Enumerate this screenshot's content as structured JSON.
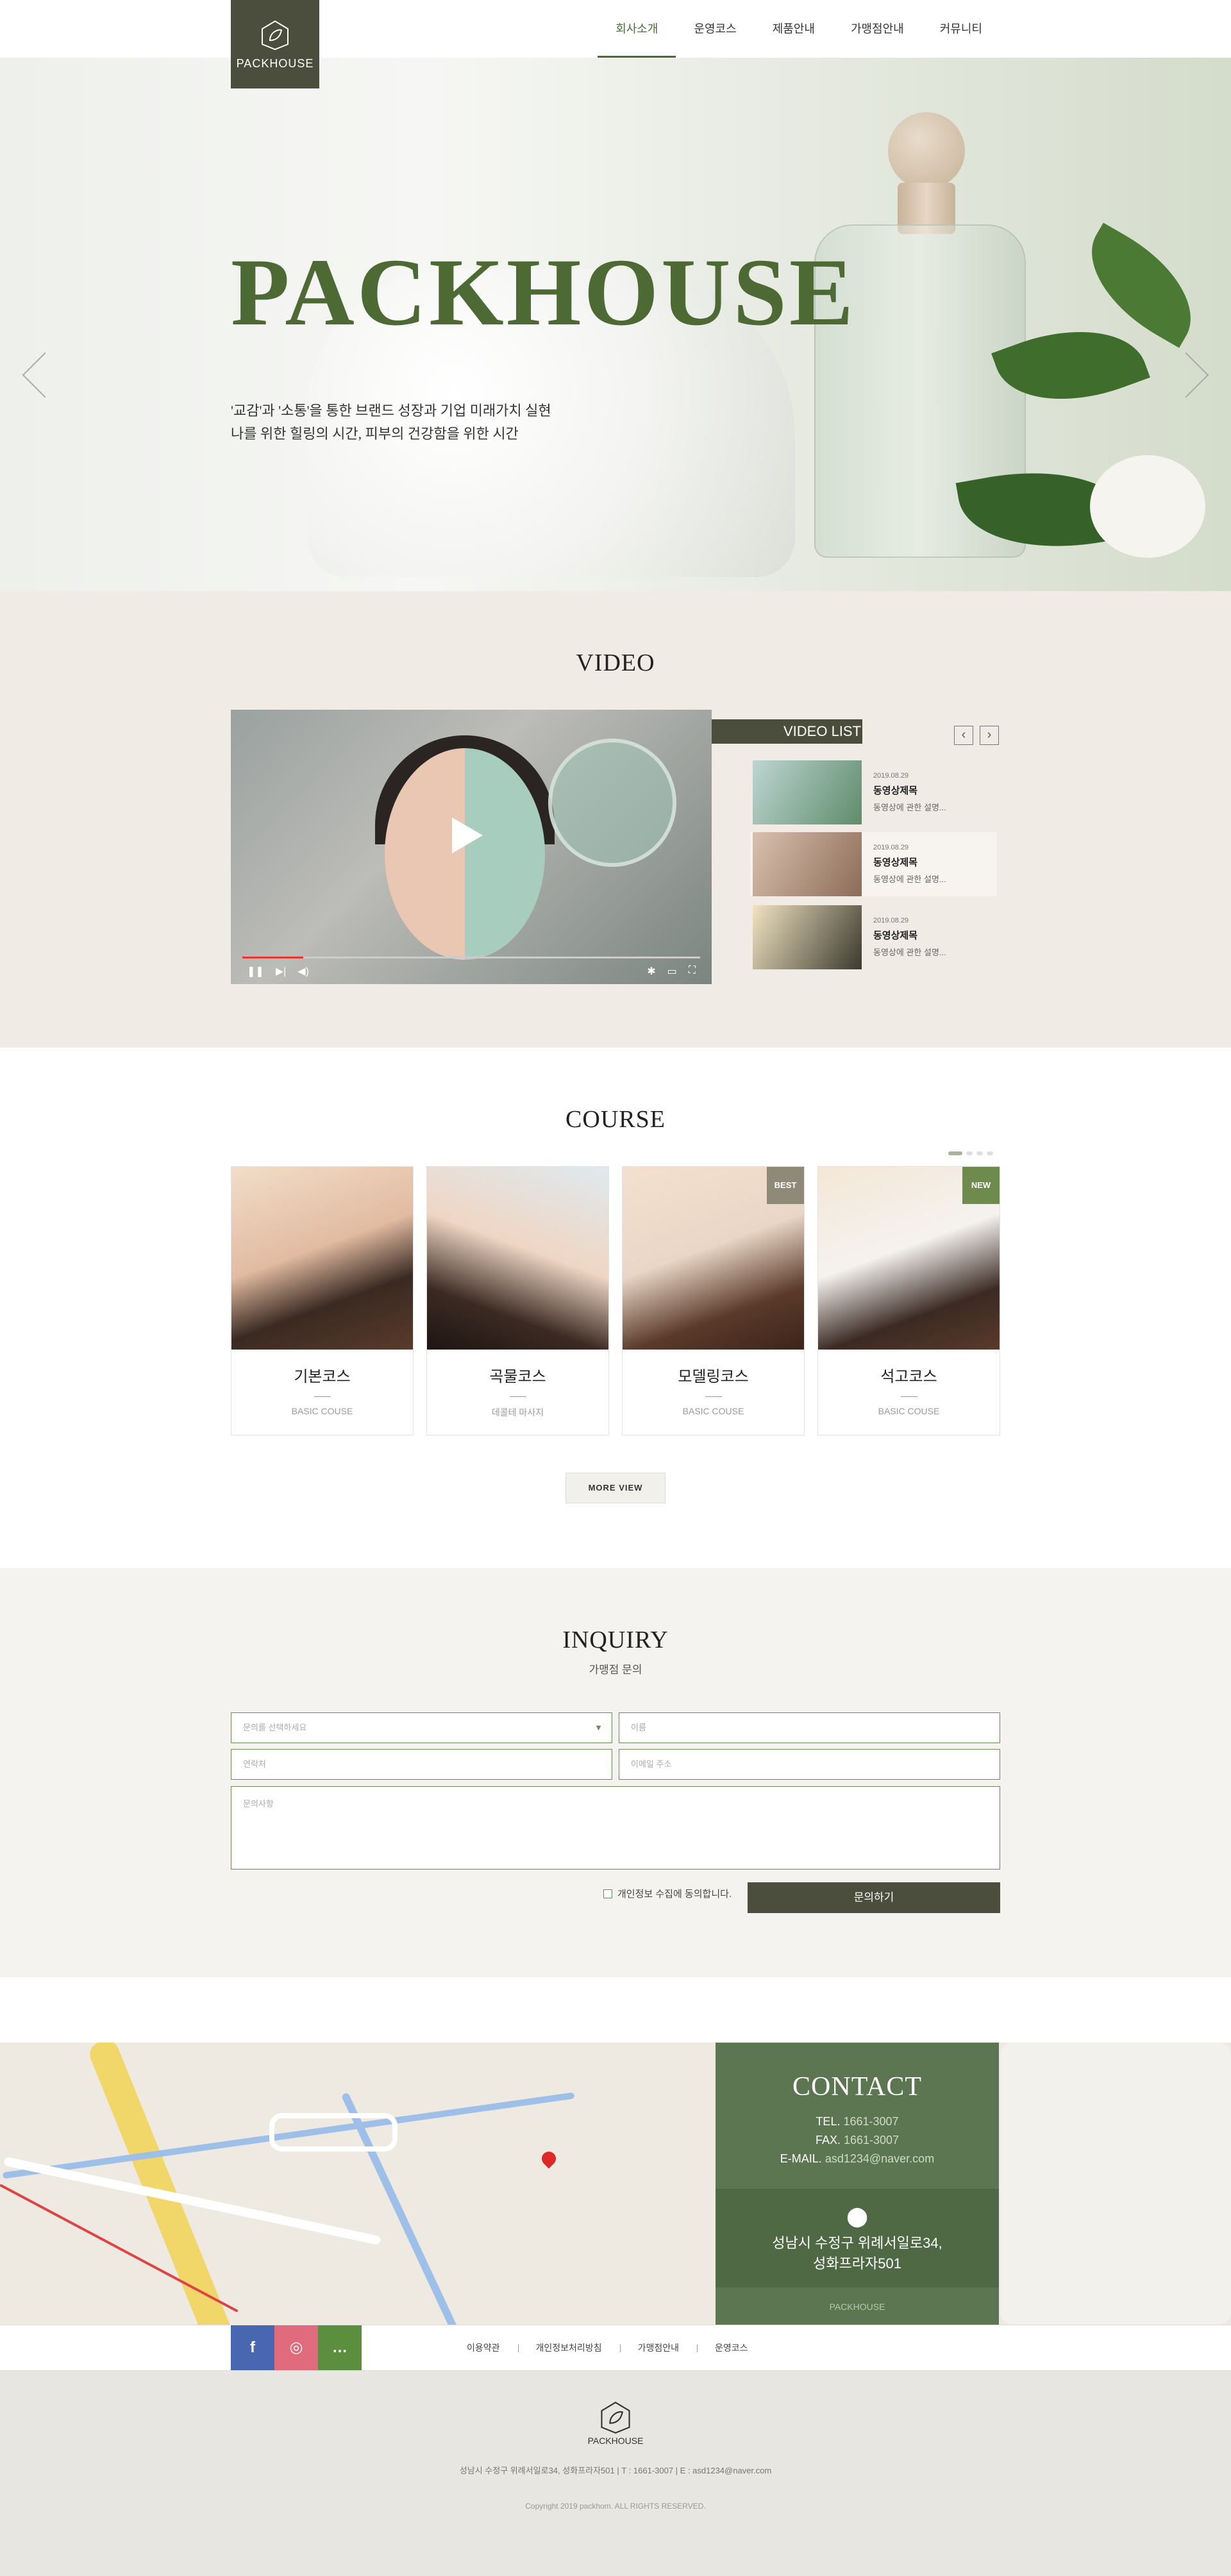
{
  "header": {
    "logo_text": "PACKHOUSE",
    "nav": [
      "회사소개",
      "운영코스",
      "제품안내",
      "가맹점안내",
      "커뮤니티"
    ]
  },
  "hero": {
    "title": "PACKHOUSE",
    "sub_line1": "'교감'과 '소통'을 통한 브랜드 성장과 기업 미래가치 실현",
    "sub_line2": "나를 위한 힐링의 시간, 피부의 건강함을 위한 시간",
    "prev_icon": "chevron-left-icon",
    "next_icon": "chevron-right-icon"
  },
  "video": {
    "title": "VIDEO",
    "list_title": "VIDEO LIST",
    "items": [
      {
        "date": "2019.08.29",
        "title": "동영상제목",
        "desc": "동영상에 관한 설명..."
      },
      {
        "date": "2019.08.29",
        "title": "동영상제목",
        "desc": "동영상에 관한 설명..."
      },
      {
        "date": "2019.08.29",
        "title": "동영상제목",
        "desc": "동영상에 관한 설명..."
      }
    ]
  },
  "course": {
    "title": "COURSE",
    "cards": [
      {
        "name": "기본코스",
        "desc": "BASIC COUSE",
        "badge": ""
      },
      {
        "name": "곡물코스",
        "desc": "데콜테 마사지",
        "badge": ""
      },
      {
        "name": "모델링코스",
        "desc": "BASIC COUSE",
        "badge": "BEST"
      },
      {
        "name": "석고코스",
        "desc": "BASIC COUSE",
        "badge": "NEW"
      }
    ],
    "more_label": "MORE VIEW",
    "colors": {
      "best": "#8f8a77",
      "new": "#6e8a4d"
    }
  },
  "inquiry": {
    "title": "INQUIRY",
    "subtitle": "가맹점 문의",
    "select_placeholder": "문의를 선택하세요",
    "name_placeholder": "이름",
    "phone_placeholder": "연락처",
    "email_placeholder": "이메일 주소",
    "message_placeholder": "문의사항",
    "agree_label": "개인정보 수집에 동의합니다.",
    "submit_label": "문의하기"
  },
  "contact": {
    "title": "CONTACT",
    "tel": "1661-3007",
    "fax": "1661-3007",
    "email": "asd1234@naver.com",
    "address_line1": "성남시 수정구 위례서일로34,",
    "address_line2": "성화프라자501",
    "brand": "PACKHOUSE"
  },
  "footer": {
    "sns": [
      "f",
      "◎",
      "…"
    ],
    "links": [
      "이용약관",
      "개인정보처리방침",
      "가맹점안내",
      "운영코스"
    ],
    "logo_text": "PACKHOUSE",
    "address": "성남시 수정구 위례서일로34, 성화프라자501  |  T : 1661-3007  |  E : asd1234@naver.com",
    "copyright": "Copyright 2019 packhom. ALL RIGHTS RESERVED."
  }
}
